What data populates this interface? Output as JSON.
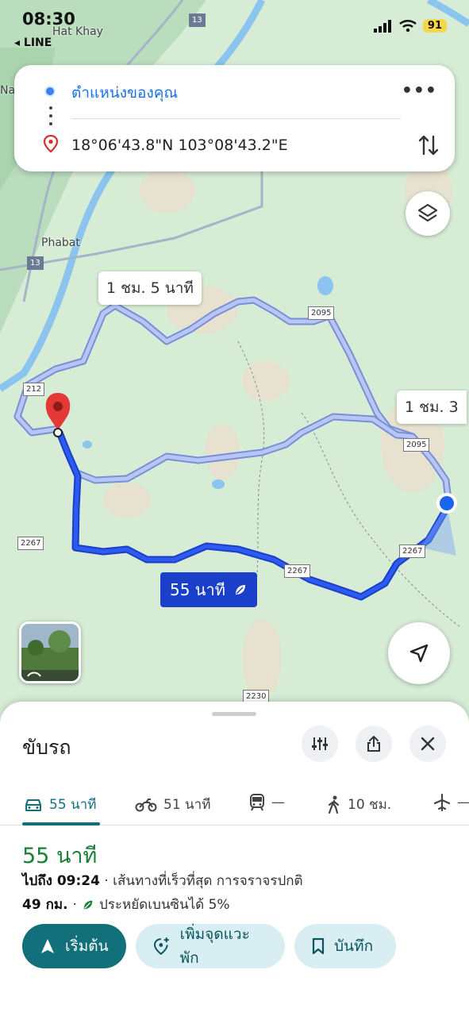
{
  "status_bar": {
    "time": "08:30",
    "back_label": "◂ LINE",
    "battery": "91"
  },
  "search": {
    "origin": "ตำแหน่งของคุณ",
    "destination": "18°06'43.8\"N 103°08'43.2\"E"
  },
  "map": {
    "places": {
      "hat_khay": "Hat Khay",
      "phabat": "Phabat",
      "na": "Na"
    },
    "road_shields": {
      "r13a": "13",
      "r13b": "13",
      "r2095a": "2095",
      "r2095b": "2095",
      "r212": "212",
      "r2267a": "2267",
      "r2267b": "2267",
      "r2267c": "2267",
      "r2230": "2230"
    },
    "route_labels": {
      "alt1": "1 ชม. 5 นาที",
      "alt2": "1 ชม. 3",
      "main": "55 นาที"
    },
    "colors": {
      "route_main": "#1a3fc9",
      "route_alt": "#9fb4f0",
      "map_bg": "#d6ecd5"
    }
  },
  "sheet": {
    "title": "ขับรถ",
    "modes": [
      {
        "name": "car",
        "label": "55 นาที"
      },
      {
        "name": "motorcycle",
        "label": "51 นาที"
      },
      {
        "name": "transit",
        "label": "—"
      },
      {
        "name": "walk",
        "label": "10 ชม."
      },
      {
        "name": "flight",
        "label": "—"
      }
    ],
    "eta": "55 นาที",
    "arrive_prefix": "ไปถึง 09:24",
    "arrive_suffix": " · เส้นทางที่เร็วที่สุด การจราจรปกติ",
    "distance": "49 กม.",
    "eco": "ประหยัดเบนซินได้ 5%",
    "buttons": {
      "start": "เริ่มต้น",
      "add_stop": "เพิ่มจุดแวะพัก",
      "save": "บันทึก"
    }
  }
}
